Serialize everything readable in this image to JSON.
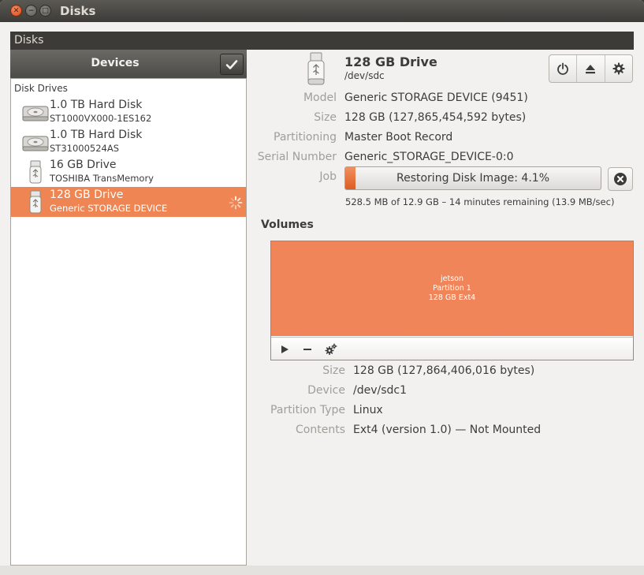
{
  "window": {
    "title": "Disks"
  },
  "menubar": {
    "label": "Disks"
  },
  "sidebar": {
    "header": "Devices",
    "section_label": "Disk Drives",
    "drives": [
      {
        "name": "1.0 TB Hard Disk",
        "sub": "ST1000VX000-1ES162",
        "icon": "hard-disk-icon"
      },
      {
        "name": "1.0 TB Hard Disk",
        "sub": "ST31000524AS",
        "icon": "hard-disk-icon"
      },
      {
        "name": "16 GB Drive",
        "sub": "TOSHIBA TransMemory",
        "icon": "usb-drive-icon"
      },
      {
        "name": "128 GB Drive",
        "sub": "Generic STORAGE DEVICE",
        "icon": "usb-drive-icon",
        "selected": true
      }
    ]
  },
  "device": {
    "title": "128 GB Drive",
    "path": "/dev/sdc",
    "props": [
      {
        "label": "Model",
        "value": "Generic STORAGE DEVICE (9451)"
      },
      {
        "label": "Size",
        "value": "128 GB (127,865,454,592 bytes)"
      },
      {
        "label": "Partitioning",
        "value": "Master Boot Record"
      },
      {
        "label": "Serial Number",
        "value": "Generic_STORAGE_DEVICE-0:0"
      }
    ],
    "job": {
      "label": "Job",
      "text": "Restoring Disk Image: 4.1%",
      "progress": 0.041,
      "detail": "528.5 MB of 12.9 GB – 14 minutes remaining (13.9 MB/sec)"
    }
  },
  "volumes": {
    "heading": "Volumes",
    "partition": {
      "line1": "jetson",
      "line2": "Partition 1",
      "line3": "128 GB Ext4"
    },
    "props": [
      {
        "label": "Size",
        "value": "128 GB (127,864,406,016 bytes)"
      },
      {
        "label": "Device",
        "value": "/dev/sdc1"
      },
      {
        "label": "Partition Type",
        "value": "Linux"
      },
      {
        "label": "Contents",
        "value": "Ext4 (version 1.0) — Not Mounted"
      }
    ]
  },
  "colors": {
    "accent": "#ee8552",
    "partition": "#f0855a",
    "titlebar": "#3c3b37"
  }
}
